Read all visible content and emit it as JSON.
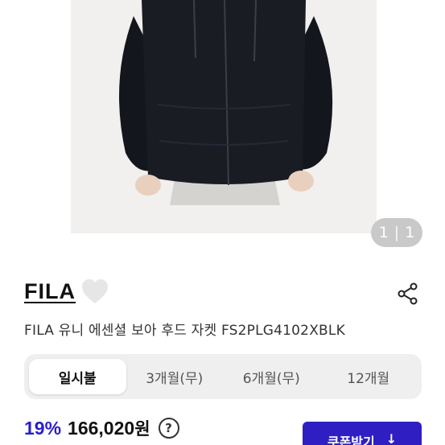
{
  "gallery": {
    "current_page": "1",
    "total_pages": "1"
  },
  "brand": {
    "name": "FILA"
  },
  "product": {
    "title": "FILA 유니 에센셜 보아 후드 자켓 FS2PLG4102XBLK"
  },
  "installment_tabs": [
    {
      "label": "일시불",
      "active": true
    },
    {
      "label": "3개월(무)",
      "active": false
    },
    {
      "label": "6개월(무)",
      "active": false
    },
    {
      "label": "12개월",
      "active": false
    }
  ],
  "price": {
    "discount": "19%",
    "amount": "166,020",
    "unit": "원",
    "help_symbol": "?"
  },
  "coupon": {
    "label": "쿠폰받기",
    "arrow": "↓"
  },
  "colors": {
    "accent": "#2f1fc2",
    "discount": "#2a1fcc",
    "tab_bg": "#efefef",
    "pill_bg": "#c9c9c9"
  },
  "icons": [
    "heart-icon",
    "share-icon",
    "help-icon",
    "download-arrow-icon"
  ]
}
